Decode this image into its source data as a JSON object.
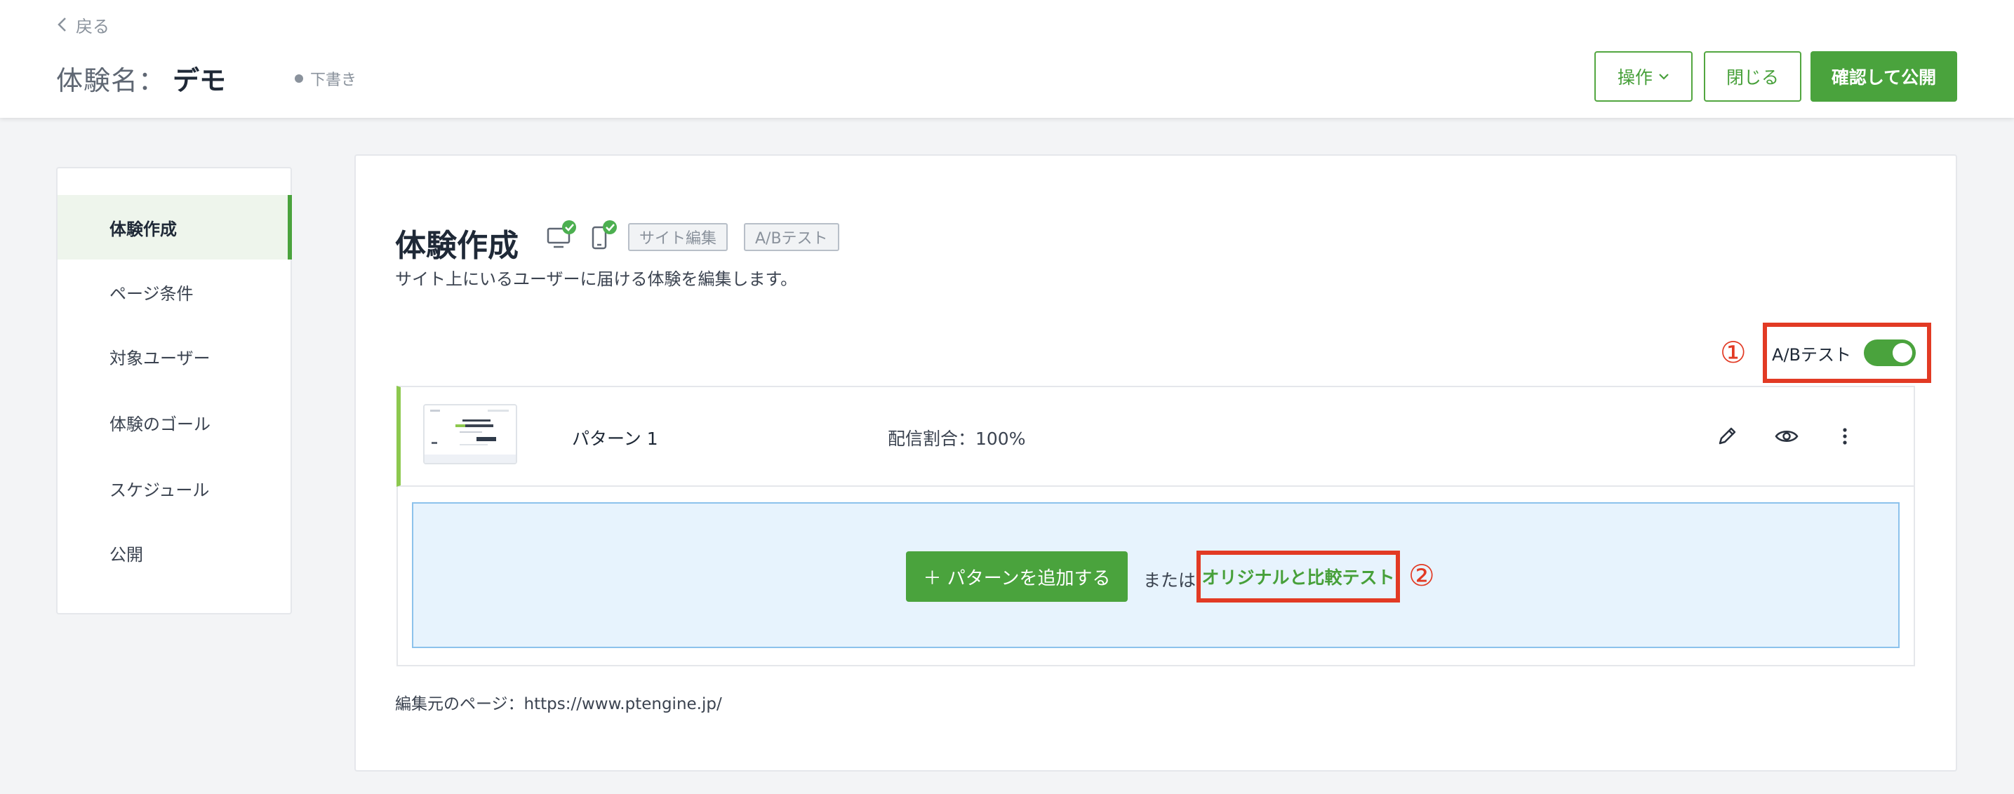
{
  "header": {
    "back_label": "戻る",
    "experience_label": "体験名：",
    "experience_name": "デモ",
    "status": "下書き",
    "actions": {
      "operations": "操作",
      "close": "閉じる",
      "publish": "確認して公開"
    }
  },
  "sidebar": {
    "items": [
      {
        "label": "体験作成",
        "active": true
      },
      {
        "label": "ページ条件"
      },
      {
        "label": "対象ユーザー"
      },
      {
        "label": "体験のゴール"
      },
      {
        "label": "スケジュール"
      },
      {
        "label": "公開"
      }
    ]
  },
  "main": {
    "title": "体験作成",
    "tags": [
      "サイト編集",
      "A/Bテスト"
    ],
    "description": "サイト上にいるユーザーに届ける体験を編集します。",
    "ab_test": {
      "label": "A/Bテスト",
      "enabled": true,
      "marker": "①"
    },
    "pattern": {
      "name": "パターン 1",
      "ratio": "配信割合：100%"
    },
    "add_pattern": {
      "button": "＋ パターンを追加する",
      "or": "または",
      "compare": "オリジナルと比較テスト",
      "marker": "②"
    },
    "source_page": "編集元のページ：https://www.ptengine.jp/"
  },
  "colors": {
    "accent": "#4aa33d",
    "highlight": "#e23a24",
    "drop_zone": "#e7f3fd"
  }
}
